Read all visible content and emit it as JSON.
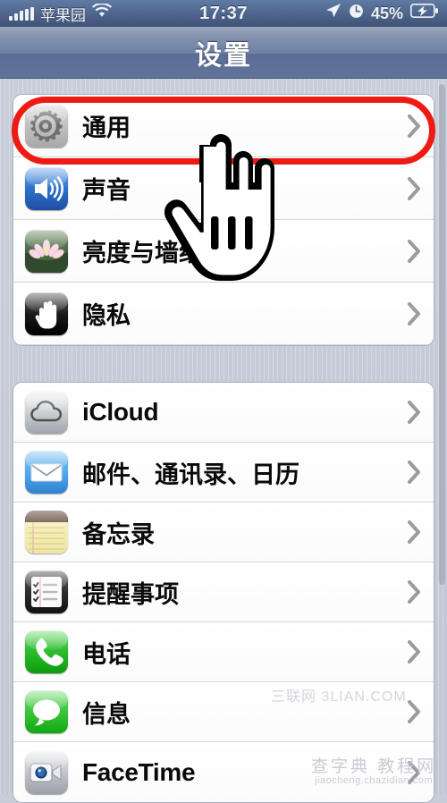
{
  "status_bar": {
    "signal_icon": "signal-bars-icon",
    "carrier": "苹果园",
    "wifi_icon": "wifi-icon",
    "time": "17:37",
    "location_icon": "location-arrow-icon",
    "alarm_icon": "alarm-clock-icon",
    "battery_percent": "45%",
    "battery_icon": "battery-charging-icon"
  },
  "nav_bar": {
    "title": "设置"
  },
  "groups": [
    {
      "id": "group-system",
      "rows": [
        {
          "name": "row-general",
          "icon": "gear-icon",
          "label": "通用",
          "chevron": "chevron-right-icon",
          "highlighted": true
        },
        {
          "name": "row-sounds",
          "icon": "speaker-icon",
          "label": "声音",
          "chevron": "chevron-right-icon",
          "highlighted": false
        },
        {
          "name": "row-brightness",
          "icon": "lotus-flower-icon",
          "label": "亮度与墙纸",
          "chevron": "chevron-right-icon",
          "highlighted": false
        },
        {
          "name": "row-privacy",
          "icon": "hand-icon",
          "label": "隐私",
          "chevron": "chevron-right-icon",
          "highlighted": false
        }
      ]
    },
    {
      "id": "group-apps",
      "rows": [
        {
          "name": "row-icloud",
          "icon": "cloud-icon",
          "label": "iCloud",
          "chevron": "chevron-right-icon",
          "latin": true
        },
        {
          "name": "row-mail",
          "icon": "envelope-icon",
          "label": "邮件、通讯录、日历",
          "chevron": "chevron-right-icon",
          "latin": false
        },
        {
          "name": "row-notes",
          "icon": "notepad-icon",
          "label": "备忘录",
          "chevron": "chevron-right-icon",
          "latin": false
        },
        {
          "name": "row-reminders",
          "icon": "checklist-icon",
          "label": "提醒事项",
          "chevron": "chevron-right-icon",
          "latin": false
        },
        {
          "name": "row-phone",
          "icon": "phone-handset-icon",
          "label": "电话",
          "chevron": "chevron-right-icon",
          "latin": false
        },
        {
          "name": "row-messages",
          "icon": "speech-bubble-icon",
          "label": "信息",
          "chevron": "chevron-right-icon",
          "latin": false
        },
        {
          "name": "row-facetime",
          "icon": "video-camera-icon",
          "label": "FaceTime",
          "chevron": "chevron-right-icon",
          "latin": true
        }
      ]
    }
  ],
  "overlay": {
    "cursor_icon": "pointing-hand-cursor",
    "highlight_color": "#ee1b13",
    "highlight_target": "row-general"
  },
  "watermarks": {
    "center": "三联网 3LIAN.COM",
    "corner_title": "查字典 教程网",
    "corner_url": "jiaocheng.chazidian.com"
  }
}
